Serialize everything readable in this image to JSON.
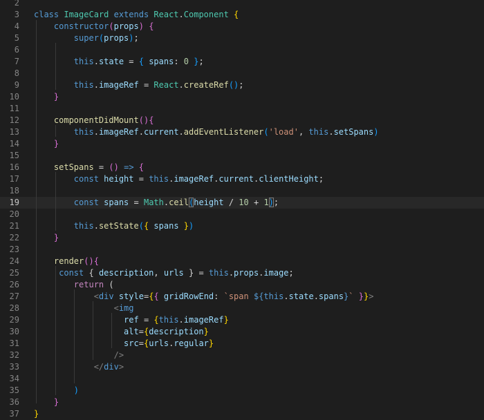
{
  "editor": {
    "language": "javascript",
    "current_line": "19",
    "lines": [
      {
        "num": "2",
        "tokens": []
      },
      {
        "num": "3",
        "tokens": [
          {
            "t": "class ",
            "c": "kw"
          },
          {
            "t": "ImageCard ",
            "c": "cls"
          },
          {
            "t": "extends ",
            "c": "kw"
          },
          {
            "t": "React",
            "c": "cls"
          },
          {
            "t": ".",
            "c": "pl"
          },
          {
            "t": "Component",
            "c": "cls"
          },
          {
            "t": " ",
            "c": "pl"
          },
          {
            "t": "{",
            "c": "b1"
          }
        ]
      },
      {
        "num": "4",
        "tokens": [
          {
            "t": "    constructor",
            "c": "kw"
          },
          {
            "t": "(",
            "c": "b2"
          },
          {
            "t": "props",
            "c": "var"
          },
          {
            "t": ")",
            "c": "b2"
          },
          {
            "t": " ",
            "c": "pl"
          },
          {
            "t": "{",
            "c": "b2"
          }
        ]
      },
      {
        "num": "5",
        "tokens": [
          {
            "t": "        super",
            "c": "kw"
          },
          {
            "t": "(",
            "c": "b3"
          },
          {
            "t": "props",
            "c": "var"
          },
          {
            "t": ")",
            "c": "b3"
          },
          {
            "t": ";",
            "c": "pl"
          }
        ]
      },
      {
        "num": "6",
        "tokens": []
      },
      {
        "num": "7",
        "tokens": [
          {
            "t": "        this",
            "c": "kw"
          },
          {
            "t": ".",
            "c": "pl"
          },
          {
            "t": "state",
            "c": "var"
          },
          {
            "t": " = ",
            "c": "pl"
          },
          {
            "t": "{",
            "c": "b3"
          },
          {
            "t": " spans",
            "c": "var"
          },
          {
            "t": ": ",
            "c": "pl"
          },
          {
            "t": "0",
            "c": "num"
          },
          {
            "t": " ",
            "c": "pl"
          },
          {
            "t": "}",
            "c": "b3"
          },
          {
            "t": ";",
            "c": "pl"
          }
        ]
      },
      {
        "num": "8",
        "tokens": []
      },
      {
        "num": "9",
        "tokens": [
          {
            "t": "        this",
            "c": "kw"
          },
          {
            "t": ".",
            "c": "pl"
          },
          {
            "t": "imageRef",
            "c": "var"
          },
          {
            "t": " = ",
            "c": "pl"
          },
          {
            "t": "React",
            "c": "cls"
          },
          {
            "t": ".",
            "c": "pl"
          },
          {
            "t": "createRef",
            "c": "fn"
          },
          {
            "t": "(",
            "c": "b3"
          },
          {
            "t": ")",
            "c": "b3"
          },
          {
            "t": ";",
            "c": "pl"
          }
        ]
      },
      {
        "num": "10",
        "tokens": [
          {
            "t": "    }",
            "c": "b2"
          }
        ]
      },
      {
        "num": "11",
        "tokens": []
      },
      {
        "num": "12",
        "tokens": [
          {
            "t": "    componentDidMount",
            "c": "fn"
          },
          {
            "t": "(",
            "c": "b2"
          },
          {
            "t": ")",
            "c": "b2"
          },
          {
            "t": "{",
            "c": "b2"
          }
        ]
      },
      {
        "num": "13",
        "tokens": [
          {
            "t": "        this",
            "c": "kw"
          },
          {
            "t": ".",
            "c": "pl"
          },
          {
            "t": "imageRef",
            "c": "var"
          },
          {
            "t": ".",
            "c": "pl"
          },
          {
            "t": "current",
            "c": "var"
          },
          {
            "t": ".",
            "c": "pl"
          },
          {
            "t": "addEventListener",
            "c": "fn"
          },
          {
            "t": "(",
            "c": "b3"
          },
          {
            "t": "'load'",
            "c": "str"
          },
          {
            "t": ", ",
            "c": "pl"
          },
          {
            "t": "this",
            "c": "kw"
          },
          {
            "t": ".",
            "c": "pl"
          },
          {
            "t": "setSpans",
            "c": "var"
          },
          {
            "t": ")",
            "c": "b3"
          }
        ]
      },
      {
        "num": "14",
        "tokens": [
          {
            "t": "    }",
            "c": "b2"
          }
        ]
      },
      {
        "num": "15",
        "tokens": []
      },
      {
        "num": "16",
        "tokens": [
          {
            "t": "    setSpans",
            "c": "fn"
          },
          {
            "t": " = ",
            "c": "pl"
          },
          {
            "t": "(",
            "c": "b2"
          },
          {
            "t": ")",
            "c": "b2"
          },
          {
            "t": " ",
            "c": "pl"
          },
          {
            "t": "=>",
            "c": "kw"
          },
          {
            "t": " ",
            "c": "pl"
          },
          {
            "t": "{",
            "c": "b2"
          }
        ]
      },
      {
        "num": "17",
        "tokens": [
          {
            "t": "        const ",
            "c": "kw"
          },
          {
            "t": "height",
            "c": "var"
          },
          {
            "t": " = ",
            "c": "pl"
          },
          {
            "t": "this",
            "c": "kw"
          },
          {
            "t": ".",
            "c": "pl"
          },
          {
            "t": "imageRef",
            "c": "var"
          },
          {
            "t": ".",
            "c": "pl"
          },
          {
            "t": "current",
            "c": "var"
          },
          {
            "t": ".",
            "c": "pl"
          },
          {
            "t": "clientHeight",
            "c": "var"
          },
          {
            "t": ";",
            "c": "pl"
          }
        ]
      },
      {
        "num": "18",
        "tokens": []
      },
      {
        "num": "19",
        "tokens": [
          {
            "t": "        const ",
            "c": "kw"
          },
          {
            "t": "spans",
            "c": "var"
          },
          {
            "t": " = ",
            "c": "pl"
          },
          {
            "t": "Math",
            "c": "cls"
          },
          {
            "t": ".",
            "c": "pl"
          },
          {
            "t": "ceil",
            "c": "fn"
          },
          {
            "t": "(",
            "c": "b3",
            "box": true
          },
          {
            "t": "height",
            "c": "var"
          },
          {
            "t": " / ",
            "c": "pl"
          },
          {
            "t": "10",
            "c": "num"
          },
          {
            "t": " + ",
            "c": "pl"
          },
          {
            "t": "1",
            "c": "num"
          },
          {
            "t": ")",
            "c": "b3",
            "box": true
          },
          {
            "t": ";",
            "c": "pl"
          }
        ]
      },
      {
        "num": "20",
        "tokens": []
      },
      {
        "num": "21",
        "tokens": [
          {
            "t": "        this",
            "c": "kw"
          },
          {
            "t": ".",
            "c": "pl"
          },
          {
            "t": "setState",
            "c": "fn"
          },
          {
            "t": "(",
            "c": "b3"
          },
          {
            "t": "{",
            "c": "b1"
          },
          {
            "t": " spans",
            "c": "var"
          },
          {
            "t": " ",
            "c": "pl"
          },
          {
            "t": "}",
            "c": "b1"
          },
          {
            "t": ")",
            "c": "b3"
          }
        ]
      },
      {
        "num": "22",
        "tokens": [
          {
            "t": "    }",
            "c": "b2"
          }
        ]
      },
      {
        "num": "23",
        "tokens": []
      },
      {
        "num": "24",
        "tokens": [
          {
            "t": "    render",
            "c": "fn"
          },
          {
            "t": "(",
            "c": "b2"
          },
          {
            "t": ")",
            "c": "b2"
          },
          {
            "t": "{",
            "c": "b2"
          }
        ]
      },
      {
        "num": "25",
        "tokens": [
          {
            "t": "     const ",
            "c": "kw"
          },
          {
            "t": "{ ",
            "c": "pl"
          },
          {
            "t": "description",
            "c": "var"
          },
          {
            "t": ", ",
            "c": "pl"
          },
          {
            "t": "urls",
            "c": "var"
          },
          {
            "t": " } = ",
            "c": "pl"
          },
          {
            "t": "this",
            "c": "kw"
          },
          {
            "t": ".",
            "c": "pl"
          },
          {
            "t": "props",
            "c": "var"
          },
          {
            "t": ".",
            "c": "pl"
          },
          {
            "t": "image",
            "c": "var"
          },
          {
            "t": ";",
            "c": "pl"
          }
        ]
      },
      {
        "num": "26",
        "tokens": [
          {
            "t": "        return",
            "c": "pkw"
          },
          {
            "t": " (",
            "c": "pl"
          }
        ]
      },
      {
        "num": "27",
        "tokens": [
          {
            "t": "            <",
            "c": "tag"
          },
          {
            "t": "div",
            "c": "tagn"
          },
          {
            "t": " ",
            "c": "pl"
          },
          {
            "t": "style",
            "c": "var"
          },
          {
            "t": "=",
            "c": "pl"
          },
          {
            "t": "{",
            "c": "b1"
          },
          {
            "t": "{",
            "c": "b2"
          },
          {
            "t": " gridRowEnd",
            "c": "var"
          },
          {
            "t": ": ",
            "c": "pl"
          },
          {
            "t": "`span ",
            "c": "str"
          },
          {
            "t": "${",
            "c": "kw"
          },
          {
            "t": "this",
            "c": "kw"
          },
          {
            "t": ".",
            "c": "pl"
          },
          {
            "t": "state",
            "c": "var"
          },
          {
            "t": ".",
            "c": "pl"
          },
          {
            "t": "spans",
            "c": "var"
          },
          {
            "t": "}",
            "c": "kw"
          },
          {
            "t": "`",
            "c": "str"
          },
          {
            "t": " ",
            "c": "pl"
          },
          {
            "t": "}",
            "c": "b2"
          },
          {
            "t": "}",
            "c": "b1"
          },
          {
            "t": ">",
            "c": "tag"
          }
        ]
      },
      {
        "num": "28",
        "tokens": [
          {
            "t": "                <",
            "c": "tag"
          },
          {
            "t": "img",
            "c": "tagn"
          }
        ]
      },
      {
        "num": "29",
        "tokens": [
          {
            "t": "                  ref",
            "c": "var"
          },
          {
            "t": " = ",
            "c": "pl"
          },
          {
            "t": "{",
            "c": "b1"
          },
          {
            "t": "this",
            "c": "kw"
          },
          {
            "t": ".",
            "c": "pl"
          },
          {
            "t": "imageRef",
            "c": "var"
          },
          {
            "t": "}",
            "c": "b1"
          }
        ]
      },
      {
        "num": "30",
        "tokens": [
          {
            "t": "                  alt",
            "c": "var"
          },
          {
            "t": "=",
            "c": "pl"
          },
          {
            "t": "{",
            "c": "b1"
          },
          {
            "t": "description",
            "c": "var"
          },
          {
            "t": "}",
            "c": "b1"
          }
        ]
      },
      {
        "num": "31",
        "tokens": [
          {
            "t": "                  src",
            "c": "var"
          },
          {
            "t": "=",
            "c": "pl"
          },
          {
            "t": "{",
            "c": "b1"
          },
          {
            "t": "urls",
            "c": "var"
          },
          {
            "t": ".",
            "c": "pl"
          },
          {
            "t": "regular",
            "c": "var"
          },
          {
            "t": "}",
            "c": "b1"
          }
        ]
      },
      {
        "num": "32",
        "tokens": [
          {
            "t": "                />",
            "c": "tag"
          }
        ]
      },
      {
        "num": "33",
        "tokens": [
          {
            "t": "            </",
            "c": "tag"
          },
          {
            "t": "div",
            "c": "tagn"
          },
          {
            "t": ">",
            "c": "tag"
          }
        ]
      },
      {
        "num": "34",
        "tokens": []
      },
      {
        "num": "35",
        "tokens": [
          {
            "t": "        )",
            "c": "b3"
          }
        ]
      },
      {
        "num": "36",
        "tokens": [
          {
            "t": "    }",
            "c": "b2"
          }
        ]
      },
      {
        "num": "37",
        "tokens": [
          {
            "t": "}",
            "c": "b1"
          }
        ]
      }
    ]
  }
}
